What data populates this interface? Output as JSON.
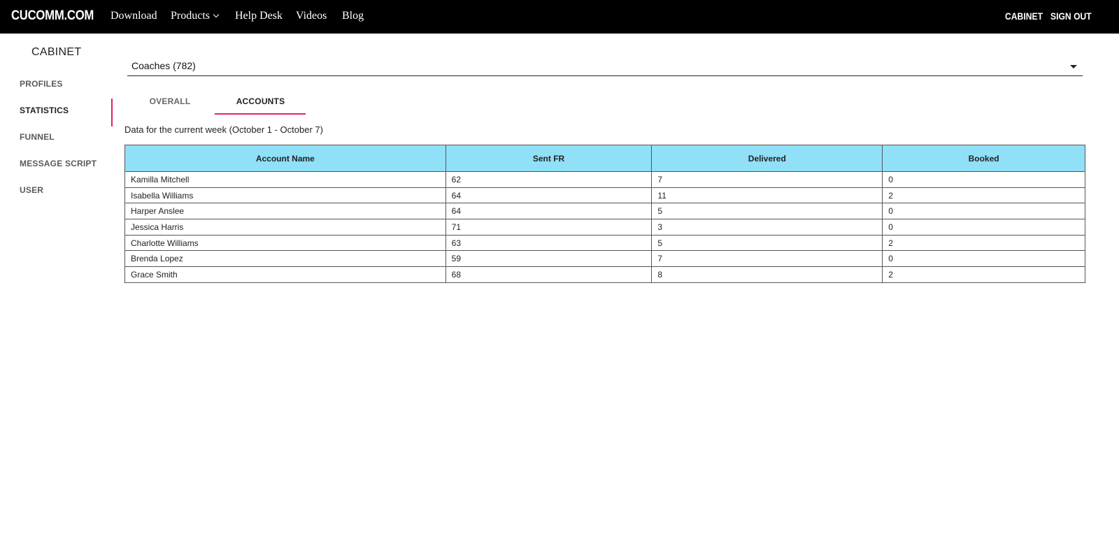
{
  "brand": "CUCOMM.COM",
  "nav": {
    "download": "Download",
    "products": "Products",
    "help_desk": "Help Desk",
    "videos": "Videos",
    "blog": "Blog"
  },
  "top_right": {
    "cabinet": "CABINET",
    "sign_out": "SIGN OUT"
  },
  "sidebar": {
    "title": "CABINET",
    "items": [
      {
        "label": "PROFILES",
        "active": false
      },
      {
        "label": "STATISTICS",
        "active": true
      },
      {
        "label": "FUNNEL",
        "active": false
      },
      {
        "label": "MESSAGE SCRIPT",
        "active": false
      },
      {
        "label": "USER",
        "active": false
      }
    ]
  },
  "select": {
    "value": "Coaches (782)"
  },
  "tabs": {
    "overall": "OVERALL",
    "accounts": "ACCOUNTS",
    "active": "accounts"
  },
  "week_note": "Data for the current week (October 1 - October 7)",
  "table": {
    "headers": [
      "Account Name",
      "Sent FR",
      "Delivered",
      "Booked"
    ],
    "rows": [
      [
        "Kamilla Mitchell",
        "62",
        "7",
        "0"
      ],
      [
        "Isabella Williams",
        "64",
        "11",
        "2"
      ],
      [
        "Harper Anslee",
        "64",
        "5",
        "0"
      ],
      [
        "Jessica Harris",
        "71",
        "3",
        "0"
      ],
      [
        "Charlotte Williams",
        "63",
        "5",
        "2"
      ],
      [
        "Brenda Lopez",
        "59",
        "7",
        "0"
      ],
      [
        "Grace Smith",
        "68",
        "8",
        "2"
      ]
    ]
  },
  "colors": {
    "accent": "#e91e63",
    "table_header_bg": "#90e0f8",
    "topbar_bg": "#000000"
  },
  "icons": {
    "products_dropdown": "chevron-down-icon",
    "select_dropdown": "caret-down-icon"
  }
}
